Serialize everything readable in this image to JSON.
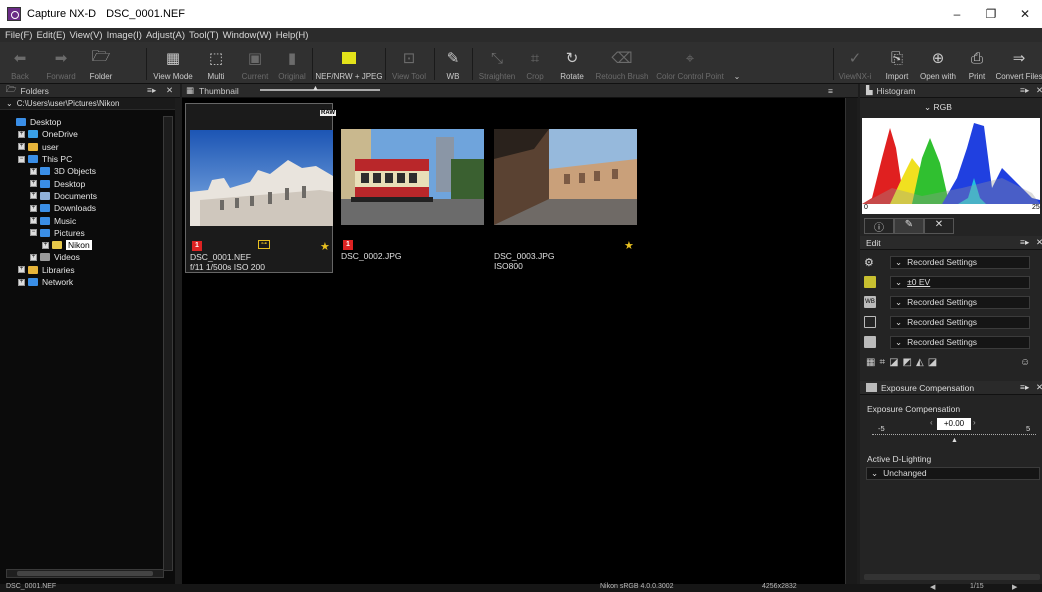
{
  "window": {
    "app": "Capture NX-D",
    "file": "DSC_0001.NEF",
    "controls": [
      "–",
      "❐",
      "✕"
    ]
  },
  "menu": [
    "File(F)",
    "Edit(E)",
    "View(V)",
    "Image(I)",
    "Adjust(A)",
    "Tool(T)",
    "Window(W)",
    "Help(H)"
  ],
  "toolbar": {
    "back": "Back",
    "forward": "Forward",
    "folder": "Folder",
    "view_mode": "View Mode",
    "multi": "Multi",
    "current": "Current",
    "original": "Original",
    "nef_jpeg": "NEF/NRW + JPEG",
    "view_tool": "View Tool",
    "wb": "WB",
    "straighten": "Straighten",
    "crop": "Crop",
    "rotate": "Rotate",
    "retouch_brush": "Retouch Brush",
    "color_control_point": "Color Control Point",
    "viewnx": "ViewNX-i",
    "import": "Import",
    "open_with": "Open with",
    "print": "Print",
    "convert_files": "Convert Files"
  },
  "folders_panel": {
    "title": "Folders",
    "path": "C:\\Users\\user\\Pictures\\Nikon",
    "tree": [
      {
        "label": "Desktop",
        "level": 0,
        "expander": ""
      },
      {
        "label": "OneDrive",
        "level": 1,
        "expander": "+"
      },
      {
        "label": "user",
        "level": 1,
        "expander": "+"
      },
      {
        "label": "This PC",
        "level": 1,
        "expander": "−"
      },
      {
        "label": "3D Objects",
        "level": 2,
        "expander": "+"
      },
      {
        "label": "Desktop",
        "level": 2,
        "expander": "+"
      },
      {
        "label": "Documents",
        "level": 2,
        "expander": "+"
      },
      {
        "label": "Downloads",
        "level": 2,
        "expander": "+"
      },
      {
        "label": "Music",
        "level": 2,
        "expander": "+"
      },
      {
        "label": "Pictures",
        "level": 2,
        "expander": "−"
      },
      {
        "label": "Nikon",
        "level": 3,
        "expander": "+"
      },
      {
        "label": "Videos",
        "level": 2,
        "expander": "+"
      },
      {
        "label": "Libraries",
        "level": 1,
        "expander": "+"
      },
      {
        "label": "Network",
        "level": 1,
        "expander": "+"
      }
    ]
  },
  "thumbnail_panel": {
    "title": "Thumbnail",
    "items": [
      {
        "filename": "DSC_0001.NEF",
        "meta": "f/11 1/500s ISO 200",
        "flag": "1",
        "raw_badge": "RAW",
        "selected": true
      },
      {
        "filename": "DSC_0002.JPG",
        "meta": "",
        "flag": "1"
      },
      {
        "filename": "DSC_0003.JPG",
        "meta": "ISO800",
        "flag": ""
      }
    ]
  },
  "histogram_panel": {
    "title": "Histogram",
    "channel": "RGB",
    "axis_min": "0",
    "axis_max": "25"
  },
  "edit_panel": {
    "title": "Edit",
    "rows": [
      {
        "value": "Recorded Settings"
      },
      {
        "value": "±0 EV"
      },
      {
        "value": "Recorded Settings"
      },
      {
        "value": "Recorded Settings"
      },
      {
        "value": "Recorded Settings"
      }
    ]
  },
  "exposure_panel": {
    "title": "Exposure Compensation",
    "label": "Exposure Compensation",
    "min": "-5",
    "max": "5",
    "value": "+0.00",
    "dlighting_label": "Active D-Lighting",
    "dlighting_value": "Unchanged"
  },
  "status": {
    "file": "DSC_0001.NEF",
    "profile": "Nikon sRGB 4.0.0.3002",
    "dimensions": "4256x2832",
    "page": "1/15"
  }
}
